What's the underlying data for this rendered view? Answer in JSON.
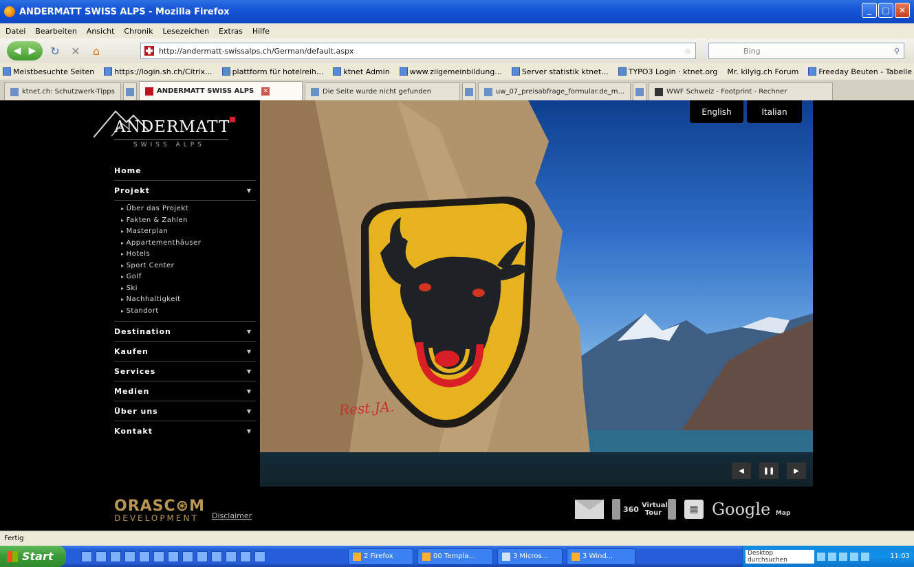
{
  "window": {
    "title": "ANDERMATT SWISS ALPS - Mozilla Firefox"
  },
  "menu": [
    "Datei",
    "Bearbeiten",
    "Ansicht",
    "Chronik",
    "Lesezeichen",
    "Extras",
    "Hilfe"
  ],
  "address": {
    "url": "http://andermatt-swissalps.ch/German/default.aspx"
  },
  "search": {
    "placeholder": "Bing"
  },
  "bookmarks": [
    "Meistbesuchte Seiten",
    "https://login.sh.ch/Citrix...",
    "plattform für hotelreih...",
    "ktnet Admin",
    "www.zilgemeinbildung...",
    "Server statistik ktnet...",
    "TYPO3 Login · ktnet.org",
    "Mr. kilyig.ch Forum",
    "Freeday Beuten - Tabelle"
  ],
  "tabs": [
    {
      "label": "ktnet.ch: Schutzwerk-Tipps",
      "active": false
    },
    {
      "label": "ANDERMATT SWISS ALPS",
      "active": true
    },
    {
      "label": "Die Seite wurde nicht gefunden",
      "active": false
    },
    {
      "label": "uw_07_preisabfrage_formular.de_m...",
      "active": false
    },
    {
      "label": "WWF Schweiz - Footprint - Rechner",
      "active": false
    }
  ],
  "logo": {
    "name": "ANDERMATT",
    "tagline": "SWISS ALPS"
  },
  "nav": {
    "home": "Home",
    "projekt": "Projekt",
    "projekt_items": [
      "Über das Projekt",
      "Fakten & Zahlen",
      "Masterplan",
      "Appartementhäuser",
      "Hotels",
      "Sport Center",
      "Golf",
      "Ski",
      "Nachhaltigkeit",
      "Standort"
    ],
    "destination": "Destination",
    "kaufen": "Kaufen",
    "services": "Services",
    "medien": "Medien",
    "ueber_uns": "Über uns",
    "kontakt": "Kontakt"
  },
  "languages": {
    "english": "English",
    "italian": "Italian"
  },
  "hero": {
    "graffiti": "Rest.JA."
  },
  "slideshow": {
    "prev": "◀",
    "pause": "❚❚",
    "next": "▶"
  },
  "footer": {
    "orascom_top": "ORASC⊛M",
    "orascom_bottom": "DEVELOPMENT",
    "disclaimer": "Disclaimer",
    "tour_360": "360",
    "tour_label": "Virtual Tour",
    "google": "Google",
    "map": "Map"
  },
  "status": {
    "text": "Fertig"
  },
  "taskbar": {
    "start": "Start",
    "tasks": [
      "2 Firefox",
      "00 Templa...",
      "3 Micros...",
      "3 Wind..."
    ],
    "search_text": "Desktop durchsuchen",
    "clock": "11:03"
  }
}
